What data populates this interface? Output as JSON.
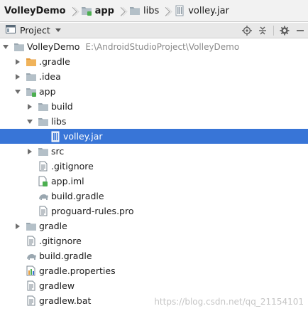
{
  "breadcrumb": {
    "items": [
      {
        "label": "VolleyDemo",
        "bold": true,
        "icon": "none"
      },
      {
        "label": "app",
        "bold": true,
        "icon": "module-folder-icon"
      },
      {
        "label": "libs",
        "bold": false,
        "icon": "folder-icon"
      },
      {
        "label": "volley.jar",
        "bold": false,
        "icon": "jar-icon"
      }
    ]
  },
  "toolwindow": {
    "view_label": "Project",
    "actions": [
      "locate-icon",
      "collapse-all-icon",
      "gear-icon",
      "hide-icon"
    ]
  },
  "tree": {
    "rows": [
      {
        "label": "VolleyDemo",
        "path": "E:\\AndroidStudioProject\\VolleyDemo",
        "icon": "project-folder",
        "expanded": true
      },
      {
        "label": ".gradle",
        "icon": "folder-orange",
        "expanded": false
      },
      {
        "label": ".idea",
        "icon": "folder",
        "expanded": false
      },
      {
        "label": "app",
        "icon": "module-folder",
        "expanded": true
      },
      {
        "label": "build",
        "icon": "folder",
        "expanded": false
      },
      {
        "label": "libs",
        "icon": "folder",
        "expanded": true
      },
      {
        "label": "volley.jar",
        "icon": "jar",
        "selected": true
      },
      {
        "label": "src",
        "icon": "folder",
        "expanded": false
      },
      {
        "label": ".gitignore",
        "icon": "text-file"
      },
      {
        "label": "app.iml",
        "icon": "iml-file"
      },
      {
        "label": "build.gradle",
        "icon": "gradle-file"
      },
      {
        "label": "proguard-rules.pro",
        "icon": "text-file"
      },
      {
        "label": "gradle",
        "icon": "folder",
        "expanded": false
      },
      {
        "label": ".gitignore",
        "icon": "text-file"
      },
      {
        "label": "build.gradle",
        "icon": "gradle-file"
      },
      {
        "label": "gradle.properties",
        "icon": "properties-file"
      },
      {
        "label": "gradlew",
        "icon": "text-file"
      },
      {
        "label": "gradlew.bat",
        "icon": "text-file"
      }
    ]
  },
  "watermark": "https://blog.csdn.net/qq_21154101",
  "colors": {
    "selection": "#3875d7",
    "header_bg": "#e8e8e8",
    "navbar_bg": "#f2f2f2"
  }
}
